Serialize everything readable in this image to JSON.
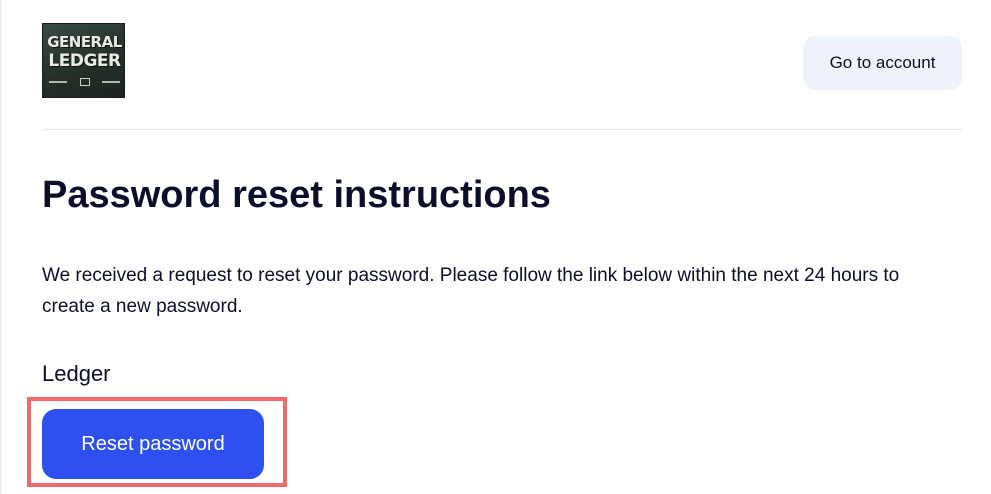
{
  "header": {
    "logo": {
      "line1": "GENERAL",
      "line2": "LEDGER"
    },
    "account_button_label": "Go to account"
  },
  "content": {
    "title": "Password reset instructions",
    "message": "We received a request to reset your password. Please follow the link below within the next 24 hours to create a new password.",
    "product_name": "Ledger",
    "reset_button_label": "Reset password"
  },
  "colors": {
    "primary_button": "#2f50f0",
    "secondary_button": "#eef3fc",
    "text": "#0b0f2a",
    "highlight": "#f06a6a",
    "divider": "#dfeaea"
  }
}
